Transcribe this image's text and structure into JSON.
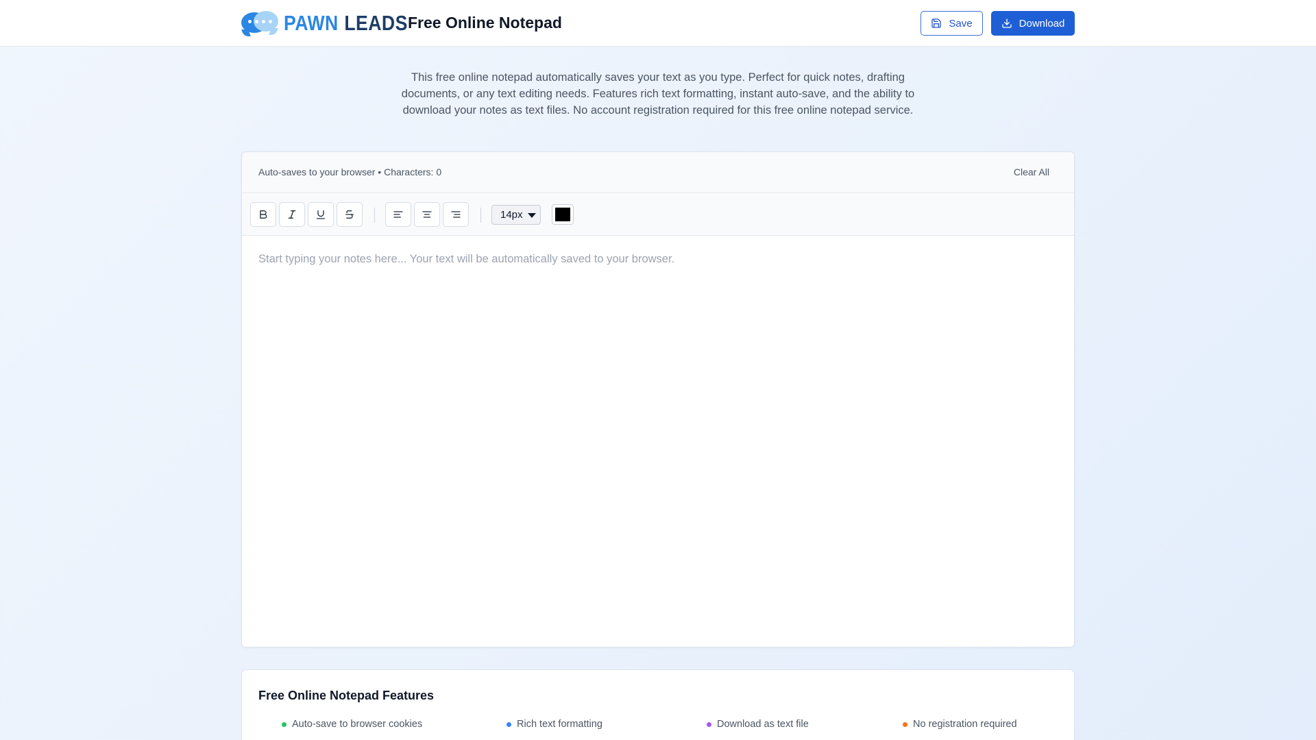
{
  "header": {
    "brand_part1": "PAWN",
    "brand_part2": "LEADS",
    "title": "Free Online Notepad",
    "save_label": "Save",
    "download_label": "Download"
  },
  "intro": {
    "text": "This free online notepad automatically saves your text as you type. Perfect for quick notes, drafting documents, or any text editing needs. Features rich text formatting, instant auto-save, and the ability to download your notes as text files. No account registration required for this free online notepad service."
  },
  "editor": {
    "status": "Auto-saves to your browser • Characters: 0",
    "clear_label": "Clear All",
    "toolbar": {
      "font_size": "14px",
      "text_color": "#000000"
    },
    "placeholder": "Start typing your notes here... Your text will be automatically saved to your browser."
  },
  "features": {
    "title": "Free Online Notepad Features",
    "items": [
      {
        "label": "Auto-save to browser cookies",
        "color": "#22c55e"
      },
      {
        "label": "Rich text formatting",
        "color": "#3b82f6"
      },
      {
        "label": "Download as text file",
        "color": "#a855f7"
      },
      {
        "label": "No registration required",
        "color": "#f97316"
      }
    ]
  },
  "colors": {
    "primary": "#1f5fd6",
    "brand_blue": "#2b86e4",
    "brand_navy": "#1d3d66"
  }
}
